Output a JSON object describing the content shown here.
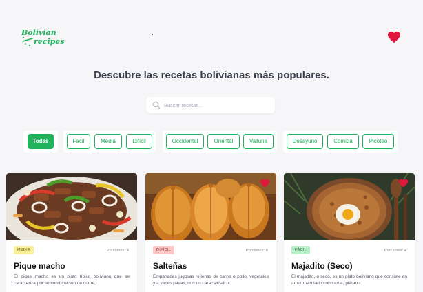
{
  "header": {
    "logo_text_line1": "Bolivian",
    "logo_text_line2": "recipes",
    "favorites_icon": "heart-icon",
    "accent_color": "#21b35c",
    "heart_color": "#e0173c"
  },
  "hero": {
    "title": "Descubre las recetas bolivianas más populares."
  },
  "search": {
    "placeholder": "Buscar recetas...",
    "icon": "search-icon"
  },
  "filters": {
    "all": "Todas",
    "difficulty": [
      "Fácil",
      "Media",
      "Difícil"
    ],
    "region": [
      "Occidental",
      "Oriental",
      "Valluna"
    ],
    "meal": [
      "Desayuno",
      "Comida",
      "Picoteo"
    ]
  },
  "recipes": [
    {
      "badge": "MEDIA",
      "badge_bg": "#fbf09a",
      "badge_color": "#6b5d00",
      "portions": "Porciones: 4",
      "title": "Pique macho",
      "description": "El pique macho es un plato típico boliviano que se caracteriza por su combinación de carne,",
      "favorited": false
    },
    {
      "badge": "DIFÍCIL",
      "badge_bg": "#fbc7c7",
      "badge_color": "#9c2b2b",
      "portions": "Porciones: 6",
      "title": "Salteñas",
      "description": "Empanadas jugosas rellenas de carne o pollo, vegetales y a veces pasas, con un característico",
      "favorited": true
    },
    {
      "badge": "FÁCIL",
      "badge_bg": "#b9f0c9",
      "badge_color": "#1b6b38",
      "portions": "Porciones: 4",
      "title": "Majadito (Seco)",
      "description": "El majadito, o seco, es un plato boliviano que consiste en arroz mezclado con carne, plátano",
      "favorited": true
    }
  ]
}
